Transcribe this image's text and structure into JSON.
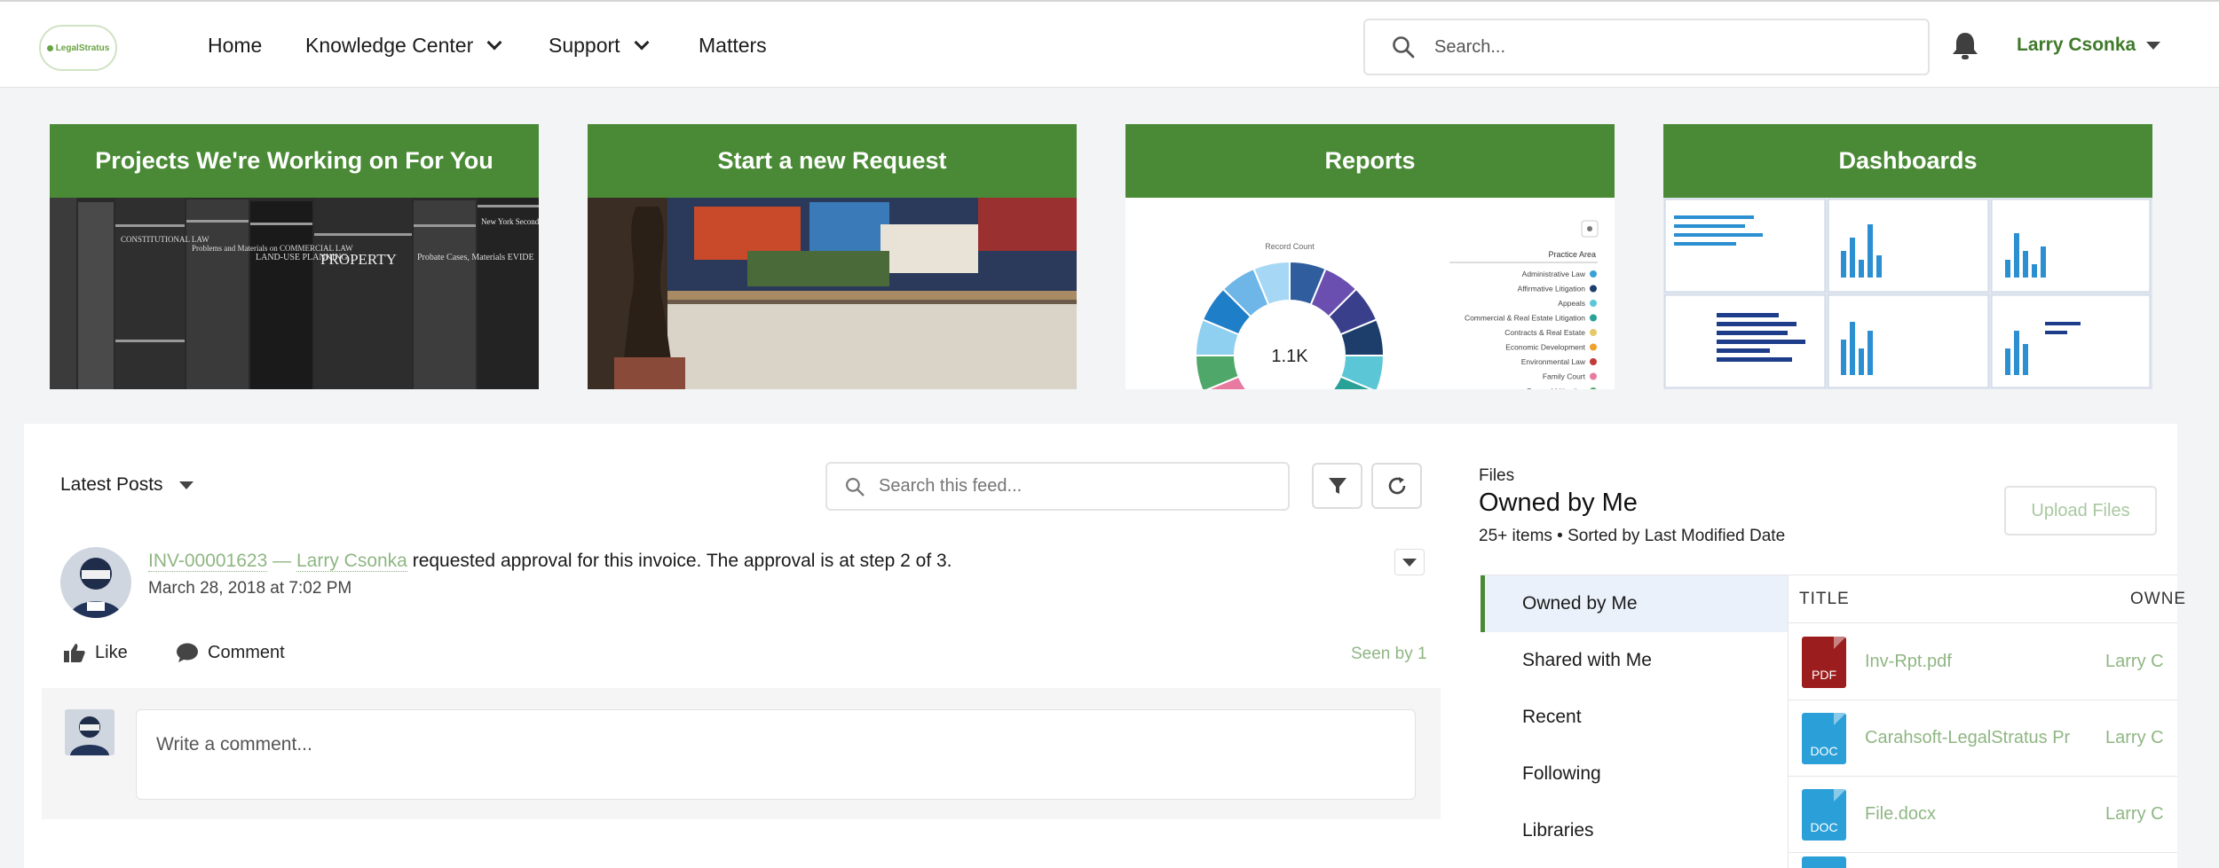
{
  "header": {
    "logo_text": "LegalStratus",
    "nav": {
      "home": "Home",
      "knowledge_center": "Knowledge Center",
      "support": "Support",
      "matters": "Matters"
    },
    "search_placeholder": "Search...",
    "user_name": "Larry Csonka"
  },
  "tiles": [
    {
      "title": "Projects We're Working on For You",
      "book_labels": [
        "CONSTITUTIONAL LAW",
        "Problems and Materials on COMMERCIAL LAW",
        "LAND-USE PLANNING",
        "PROPERTY",
        "Probate Cases, Materials EVIDE",
        "New York Second Edition"
      ]
    },
    {
      "title": "Start a new Request"
    },
    {
      "title": "Reports",
      "chart_label": "Record Count",
      "chart_center": "1.1K",
      "legend_title": "Practice Area",
      "legend": [
        {
          "name": "Administrative Law",
          "color": "#3aa1d7"
        },
        {
          "name": "Affirmative Litigation",
          "color": "#1d3d6b"
        },
        {
          "name": "Appeals",
          "color": "#5bc7d6"
        },
        {
          "name": "Commercial & Real Estate Litigation",
          "color": "#28a197"
        },
        {
          "name": "Contracts & Real Estate",
          "color": "#e3c96a"
        },
        {
          "name": "Economic Development",
          "color": "#eea12b"
        },
        {
          "name": "Environmental Law",
          "color": "#c33a3a"
        },
        {
          "name": "Family Court",
          "color": "#e87aa0"
        },
        {
          "name": "General Litigation",
          "color": "#4fa86a"
        }
      ]
    },
    {
      "title": "Dashboards"
    }
  ],
  "feed": {
    "filter_label": "Latest Posts",
    "search_placeholder": "Search this feed...",
    "post": {
      "record": "INV-00001623",
      "separator": "—",
      "author": "Larry Csonka",
      "text": "requested approval for this invoice. The approval is at step 2 of 3.",
      "timestamp": "March 28, 2018 at 7:02 PM",
      "like_label": "Like",
      "comment_label": "Comment",
      "seen_by": "Seen by 1"
    },
    "comment_placeholder": "Write a comment..."
  },
  "files": {
    "eyebrow": "Files",
    "title": "Owned by Me",
    "meta": "25+ items • Sorted by Last Modified Date",
    "upload_label": "Upload Files",
    "menu": [
      "Owned by Me",
      "Shared with Me",
      "Recent",
      "Following",
      "Libraries"
    ],
    "columns": {
      "title": "TITLE",
      "owner": "OWNE"
    },
    "rows": [
      {
        "type": "PDF",
        "name": "Inv-Rpt.pdf",
        "owner": "Larry C",
        "color": "#9c1d1d"
      },
      {
        "type": "DOC",
        "name": "Carahsoft-LegalStratus Pr",
        "owner": "Larry C",
        "color": "#2a9fd8"
      },
      {
        "type": "DOC",
        "name": "File.docx",
        "owner": "Larry C",
        "color": "#2a9fd8"
      }
    ]
  },
  "colors": {
    "brand_green": "#4a8a36",
    "link_green": "#8fb683"
  }
}
